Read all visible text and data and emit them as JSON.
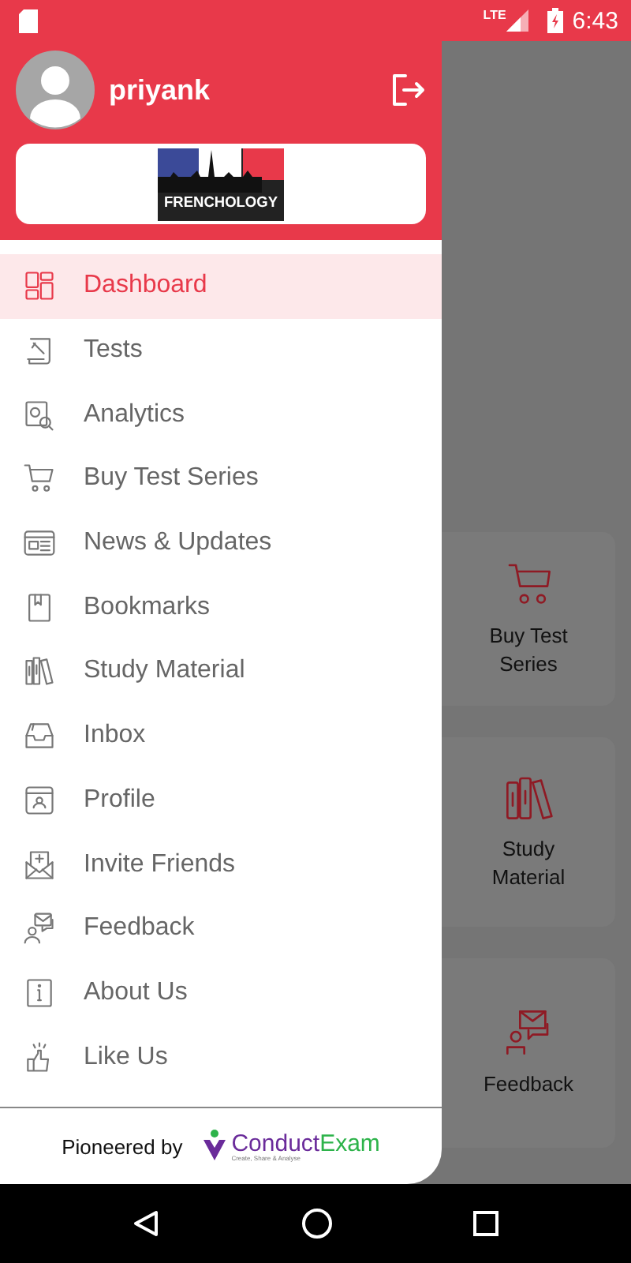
{
  "status_bar": {
    "network": "LTE",
    "time": "6:43"
  },
  "drawer": {
    "user": {
      "name": "priyank"
    },
    "logo": {
      "title": "FRENCHOLOGY"
    },
    "items": [
      {
        "label": "Dashboard",
        "selected": true
      },
      {
        "label": "Tests",
        "selected": false
      },
      {
        "label": "Analytics",
        "selected": false
      },
      {
        "label": "Buy Test Series",
        "selected": false
      },
      {
        "label": "News & Updates",
        "selected": false
      },
      {
        "label": "Bookmarks",
        "selected": false
      },
      {
        "label": "Study Material",
        "selected": false
      },
      {
        "label": "Inbox",
        "selected": false
      },
      {
        "label": "Profile",
        "selected": false
      },
      {
        "label": "Invite Friends",
        "selected": false
      },
      {
        "label": "Feedback",
        "selected": false
      },
      {
        "label": "About Us",
        "selected": false
      },
      {
        "label": "Like Us",
        "selected": false
      }
    ],
    "footer": {
      "label": "Pioneered by",
      "brand_part_1": "Conduct",
      "brand_part_2": "Exam",
      "tagline": "Create, Share & Analyse"
    }
  },
  "background_cards": [
    {
      "label": "Buy Test Series"
    },
    {
      "label": "Study Material"
    },
    {
      "label": "Feedback"
    }
  ]
}
